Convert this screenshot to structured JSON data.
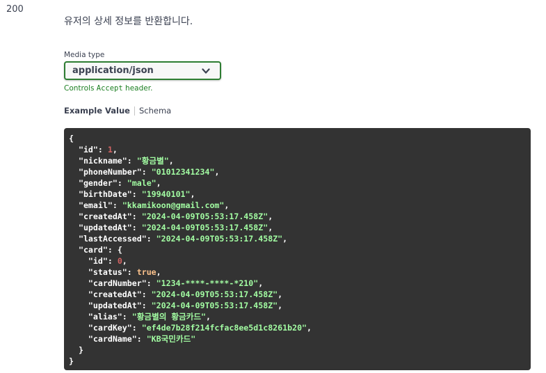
{
  "status_code": "200",
  "description": "유저의 상세 정보를 반환합니다.",
  "media_type": {
    "label": "Media type",
    "selected": "application/json",
    "note_prefix": "Controls ",
    "note_code": "Accept",
    "note_suffix": " header."
  },
  "tabs": {
    "example": "Example Value",
    "schema": "Schema"
  },
  "example": {
    "id": "1",
    "nickname": "\"황금별\"",
    "phoneNumber": "\"01012341234\"",
    "gender": "\"male\"",
    "birthDate": "\"19940101\"",
    "email": "\"kkamikoon@gmail.com\"",
    "createdAt": "\"2024-04-09T05:53:17.458Z\"",
    "updatedAt": "\"2024-04-09T05:53:17.458Z\"",
    "lastAccessed": "\"2024-04-09T05:53:17.458Z\"",
    "card": {
      "id": "0",
      "status": "true",
      "cardNumber": "\"1234-****-****-*210\"",
      "createdAt": "\"2024-04-09T05:53:17.458Z\"",
      "updatedAt": "\"2024-04-09T05:53:17.458Z\"",
      "alias": "\"황금별의 황금카드\"",
      "cardKey": "\"ef4de7b28f214fcfac8ee5d1c8261b20\"",
      "cardName": "\"KB국민카드\""
    }
  },
  "colors": {
    "code_bg": "#333333",
    "string": "#a2fca2",
    "number": "#d36363",
    "boolean": "#fcc28c",
    "select_border": "#2e7d32",
    "note": "#1b7f21"
  },
  "icons": {
    "select": "chevron-down-icon"
  }
}
